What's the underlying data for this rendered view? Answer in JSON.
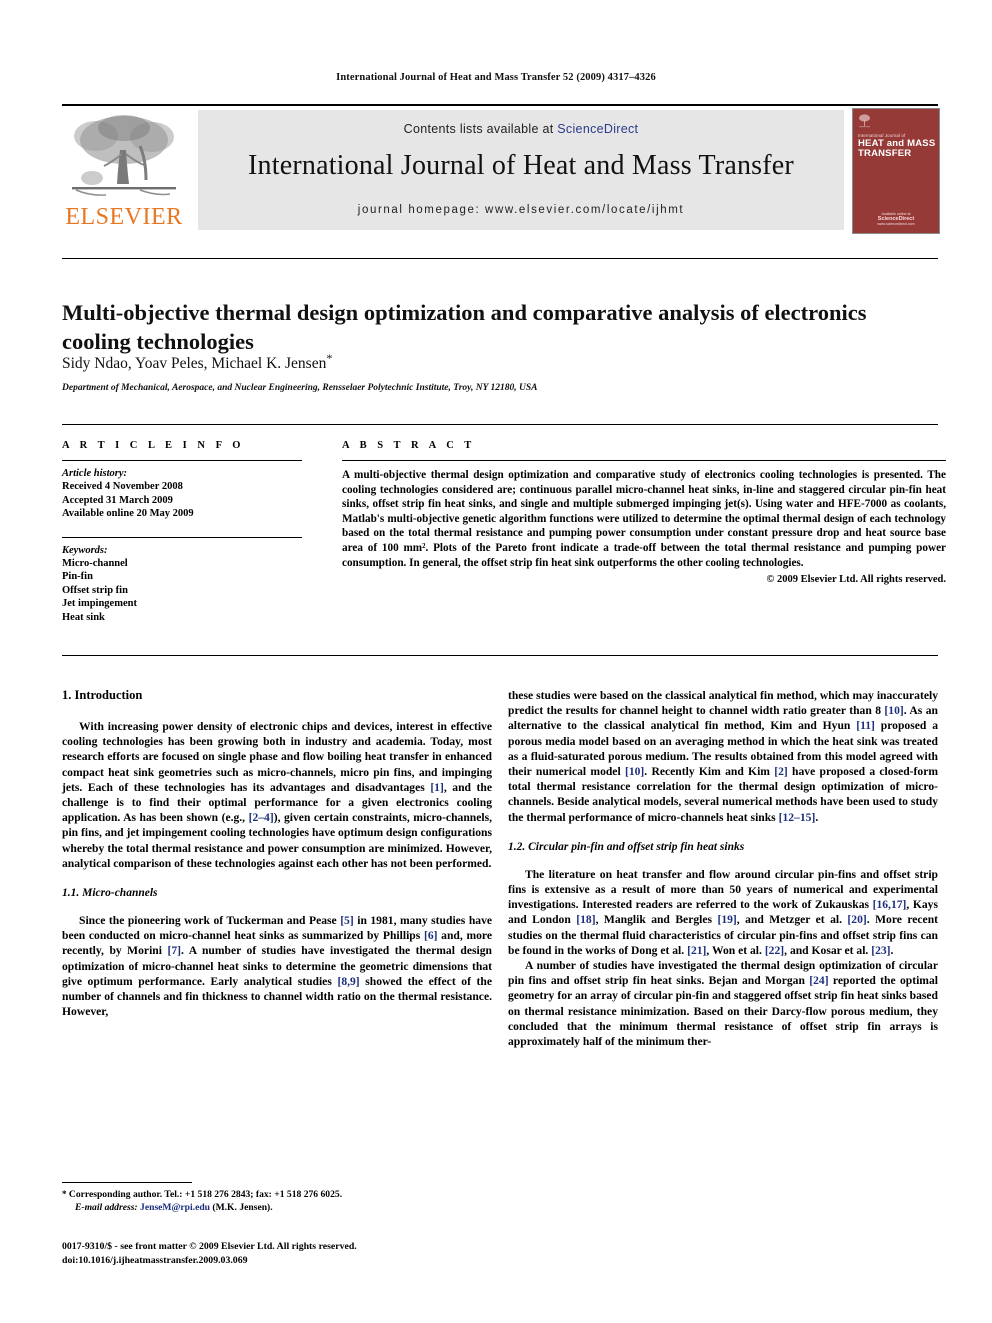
{
  "running_head": "International Journal of Heat and Mass Transfer 52 (2009) 4317–4326",
  "masthead": {
    "contents_prefix": "Contents lists available at ",
    "sciencedirect": "ScienceDirect",
    "journal_title": "International Journal of Heat and Mass Transfer",
    "homepage": "journal homepage: www.elsevier.com/locate/ijhmt",
    "publisher_name": "ELSEVIER",
    "cover": {
      "supertitle": "International Journal of",
      "maintitle": "HEAT and MASS TRANSFER",
      "footer_line1": "Available online at",
      "footer_line2": "ScienceDirect",
      "footer_line3": "www.sciencedirect.com"
    }
  },
  "article": {
    "title": "Multi-objective thermal design optimization and comparative analysis of electronics cooling technologies",
    "authors": "Sidy Ndao, Yoav Peles, Michael K. Jensen",
    "corresponding_marker": "*",
    "affiliation": "Department of Mechanical, Aerospace, and Nuclear Engineering, Rensselaer Polytechnic Institute, Troy, NY 12180, USA"
  },
  "article_info": {
    "heading": "A R T I C L E   I N F O",
    "history_label": "Article history:",
    "history": [
      "Received 4 November 2008",
      "Accepted 31 March 2009",
      "Available online 20 May 2009"
    ],
    "keywords_label": "Keywords:",
    "keywords": [
      "Micro-channel",
      "Pin-fin",
      "Offset strip fin",
      "Jet impingement",
      "Heat sink"
    ]
  },
  "abstract": {
    "heading": "A B S T R A C T",
    "text": "A multi-objective thermal design optimization and comparative study of electronics cooling technologies is presented. The cooling technologies considered are; continuous parallel micro-channel heat sinks, in-line and staggered circular pin-fin heat sinks, offset strip fin heat sinks, and single and multiple submerged impinging jet(s). Using water and HFE-7000 as coolants, Matlab's multi-objective genetic algorithm functions were utilized to determine the optimal thermal design of each technology based on the total thermal resistance and pumping power consumption under constant pressure drop and heat source base area of 100 mm². Plots of the Pareto front indicate a trade-off between the total thermal resistance and pumping power consumption. In general, the offset strip fin heat sink outperforms the other cooling technologies.",
    "copyright": "© 2009 Elsevier Ltd. All rights reserved."
  },
  "body": {
    "section1_heading": "1. Introduction",
    "section1_para1": "With increasing power density of electronic chips and devices, interest in effective cooling technologies has been growing both in industry and academia. Today, most research efforts are focused on single phase and flow boiling heat transfer in enhanced compact heat sink geometries such as micro-channels, micro pin fins, and impinging jets. Each of these technologies has its advantages and disadvantages [1], and the challenge is to find their optimal performance for a given electronics cooling application. As has been shown (e.g., [2–4]), given certain constraints, micro-channels, pin fins, and jet impingement cooling technologies have optimum design configurations whereby the total thermal resistance and power consumption are minimized. However, analytical comparison of these technologies against each other has not been performed.",
    "section11_heading": "1.1. Micro-channels",
    "section11_para1": "Since the pioneering work of Tuckerman and Pease [5] in 1981, many studies have been conducted on micro-channel heat sinks as summarized by Phillips [6] and, more recently, by Morini [7]. A number of studies have investigated the thermal design optimization of micro-channel heat sinks to determine the geometric dimensions that give optimum performance. Early analytical studies [8,9] showed the effect of the number of channels and fin thickness to channel width ratio on the thermal resistance. However,",
    "section11_para1_cont": "these studies were based on the classical analytical fin method, which may inaccurately predict the results for channel height to channel width ratio greater than 8 [10]. As an alternative to the classical analytical fin method, Kim and Hyun [11] proposed a porous media model based on an averaging method in which the heat sink was treated as a fluid-saturated porous medium. The results obtained from this model agreed with their numerical model [10]. Recently Kim and Kim [2] have proposed a closed-form total thermal resistance correlation for the thermal design optimization of micro-channels. Beside analytical models, several numerical methods have been used to study the thermal performance of micro-channels heat sinks [12–15].",
    "section12_heading": "1.2. Circular pin-fin and offset strip fin heat sinks",
    "section12_para1": "The literature on heat transfer and flow around circular pin-fins and offset strip fins is extensive as a result of more than 50 years of numerical and experimental investigations. Interested readers are referred to the work of Zukauskas [16,17], Kays and London [18], Manglik and Bergles [19], and Metzger et al. [20]. More recent studies on the thermal fluid characteristics of circular pin-fins and offset strip fins can be found in the works of Dong et al. [21], Won et al. [22], and Kosar et al. [23].",
    "section12_para2": "A number of studies have investigated the thermal design optimization of circular pin fins and offset strip fin heat sinks. Bejan and Morgan [24] reported the optimal geometry for an array of circular pin-fin and staggered offset strip fin heat sinks based on thermal resistance minimization. Based on their Darcy-flow porous medium, they concluded that the minimum thermal resistance of offset strip fin arrays is approximately half of the minimum ther-"
  },
  "footnote": {
    "corresponding": "Corresponding author. Tel.: +1 518 276 2843; fax: +1 518 276 6025.",
    "email_label": "E-mail address:",
    "email": "JenseM@rpi.edu",
    "email_owner": "(M.K. Jensen)."
  },
  "issn": {
    "line1": "0017-9310/$ - see front matter © 2009 Elsevier Ltd. All rights reserved.",
    "line2": "doi:10.1016/j.ijheatmasstransfer.2009.03.069"
  },
  "colors": {
    "link": "#1c2f7c",
    "sciencedirect": "#2b3c8c",
    "elsevier_orange": "#e87722",
    "cover_red": "#963a38",
    "band_gray": "#e6e6e6"
  }
}
